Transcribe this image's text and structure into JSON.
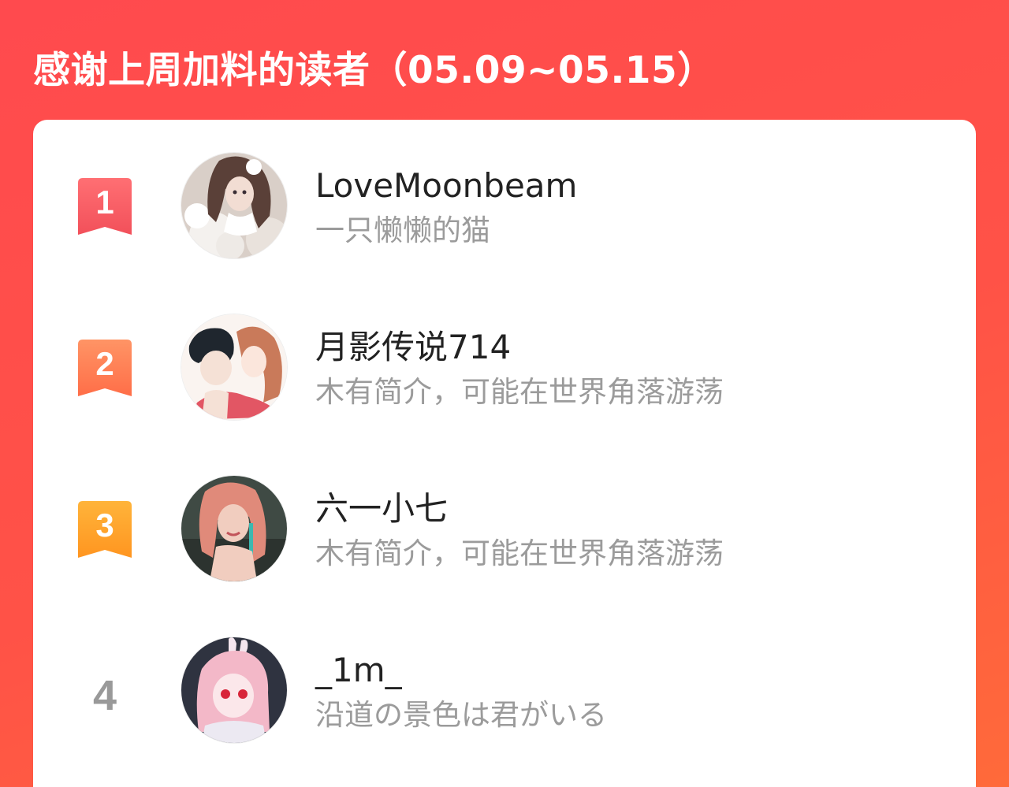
{
  "header": {
    "title": "感谢上周加料的读者（05.09~05.15）"
  },
  "colors": {
    "background_start": "#ff4a4e",
    "background_end": "#ff6a3a",
    "badge_rank_1": "#f55b61",
    "badge_rank_2": "#ff7a50",
    "badge_rank_3": "#ffa22a",
    "plain_rank": "#999999",
    "name_text": "#222222",
    "bio_text": "#9b9b9b"
  },
  "readers": [
    {
      "rank": "1",
      "name": "LoveMoonbeam",
      "bio": "一只懒懒的猫",
      "avatar": "avatar-illustration-girl-with-flowers"
    },
    {
      "rank": "2",
      "name": "月影传说714",
      "bio": "木有简介，可能在世界角落游荡",
      "avatar": "avatar-illustration-couple"
    },
    {
      "rank": "3",
      "name": "六一小七",
      "bio": "木有简介，可能在世界角落游荡",
      "avatar": "avatar-illustration-girl-pink-hair"
    },
    {
      "rank": "4",
      "name": "_1m_",
      "bio": "沿道の景色は君がいる",
      "avatar": "avatar-illustration-bunny-girl"
    }
  ]
}
